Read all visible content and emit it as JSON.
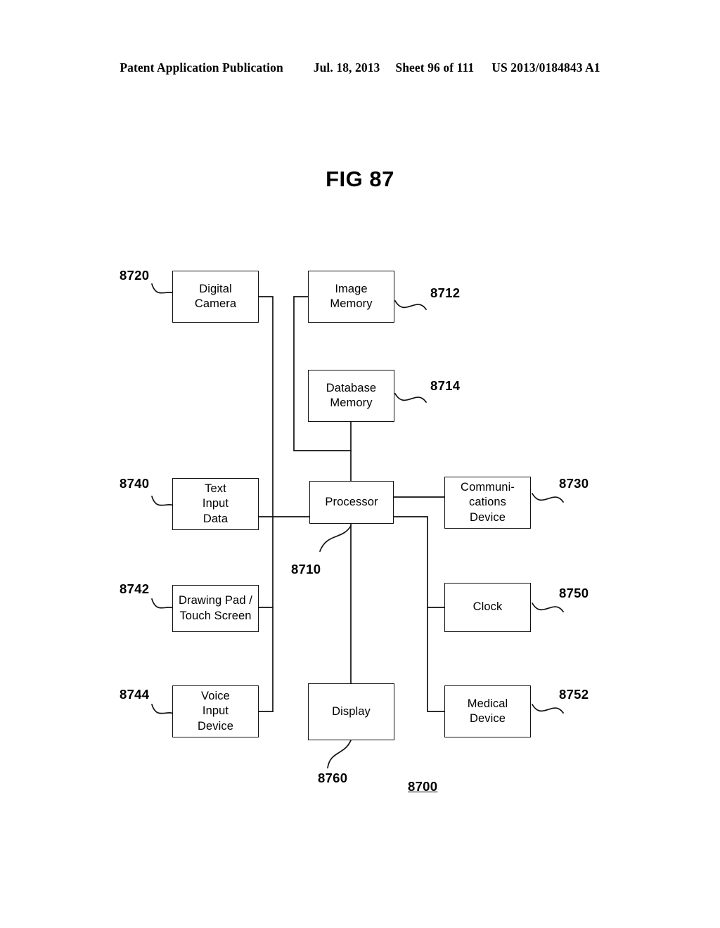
{
  "header": {
    "publication": "Patent Application Publication",
    "date": "Jul. 18, 2013",
    "sheet": "Sheet 96 of 111",
    "patent_number": "US 2013/0184843 A1"
  },
  "figure": {
    "title": "FIG 87",
    "system_ref": "8700"
  },
  "blocks": [
    {
      "id": "digital-camera",
      "label": "Digital\nCamera",
      "ref": "8720"
    },
    {
      "id": "image-memory",
      "label": "Image\nMemory",
      "ref": "8712"
    },
    {
      "id": "database-memory",
      "label": "Database\nMemory",
      "ref": "8714"
    },
    {
      "id": "text-input-data",
      "label": "Text\nInput\nData",
      "ref": "8740"
    },
    {
      "id": "processor",
      "label": "Processor",
      "ref": "8710"
    },
    {
      "id": "communications-device",
      "label": "Communi-\ncations\nDevice",
      "ref": "8730"
    },
    {
      "id": "drawing-pad",
      "label": "Drawing Pad /\nTouch Screen",
      "ref": "8742"
    },
    {
      "id": "clock",
      "label": "Clock",
      "ref": "8750"
    },
    {
      "id": "voice-input-device",
      "label": "Voice\nInput\nDevice",
      "ref": "8744"
    },
    {
      "id": "display",
      "label": "Display",
      "ref": "8760"
    },
    {
      "id": "medical-device",
      "label": "Medical\nDevice",
      "ref": "8752"
    }
  ],
  "colors": {
    "line": "#111111",
    "background": "#ffffff",
    "text": "#000000"
  }
}
